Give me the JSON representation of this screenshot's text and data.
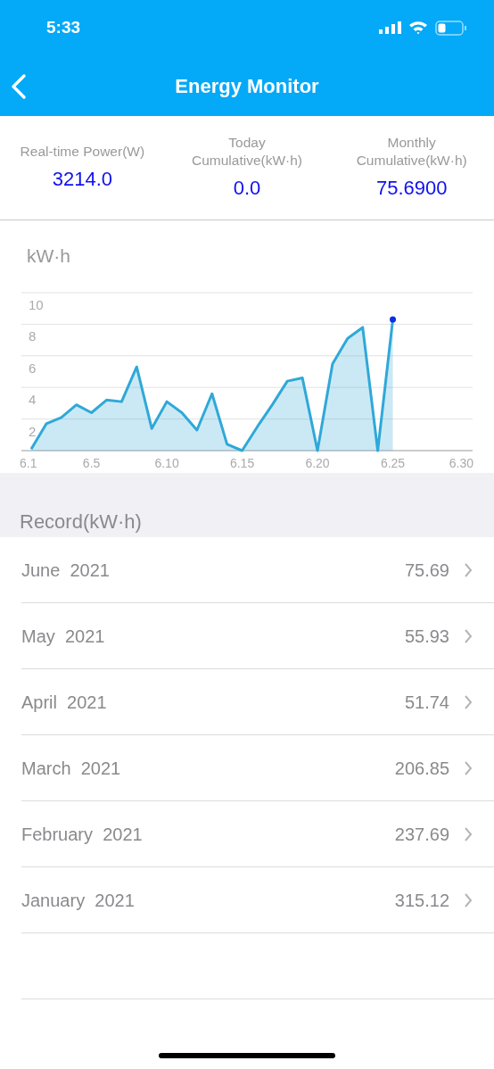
{
  "status_bar": {
    "time": "5:33"
  },
  "nav": {
    "title": "Energy Monitor"
  },
  "stats": [
    {
      "label": "Real-time Power(W)",
      "value": "3214.0"
    },
    {
      "label": "Today Cumulative(kW·h)",
      "value": "0.0"
    },
    {
      "label": "Monthly Cumulative(kW·h)",
      "value": "75.6900"
    }
  ],
  "chart": {
    "unit": "kW·h",
    "chart_data": {
      "type": "area",
      "categories": [
        "6.1",
        null,
        null,
        null,
        "6.5",
        null,
        null,
        null,
        null,
        "6.10",
        null,
        null,
        null,
        null,
        "6.15",
        null,
        null,
        null,
        null,
        "6.20",
        null,
        null,
        null,
        null,
        "6.25",
        null,
        null,
        null,
        null,
        "6.30"
      ],
      "series": [
        {
          "color": "#2fa8d8",
          "values": [
            0.1,
            1.7,
            2.1,
            2.9,
            2.4,
            3.2,
            3.1,
            5.3,
            1.4,
            3.1,
            2.4,
            1.3,
            3.6,
            0.4,
            0,
            1.5,
            2.9,
            4.4,
            4.6,
            0,
            5.5,
            7.1,
            7.8,
            0,
            8.3,
            null,
            null,
            null,
            null,
            null
          ]
        }
      ],
      "ylim": [
        0,
        10
      ],
      "grid": true,
      "yticks": [
        2,
        4,
        6,
        8,
        10
      ]
    }
  },
  "record_header": "Record(kW·h)",
  "records": [
    {
      "month": "June  2021",
      "value": "75.69"
    },
    {
      "month": "May  2021",
      "value": "55.93"
    },
    {
      "month": "April  2021",
      "value": "51.74"
    },
    {
      "month": "March  2021",
      "value": "206.85"
    },
    {
      "month": "February  2021",
      "value": "237.69"
    },
    {
      "month": "January  2021",
      "value": "315.12"
    }
  ]
}
